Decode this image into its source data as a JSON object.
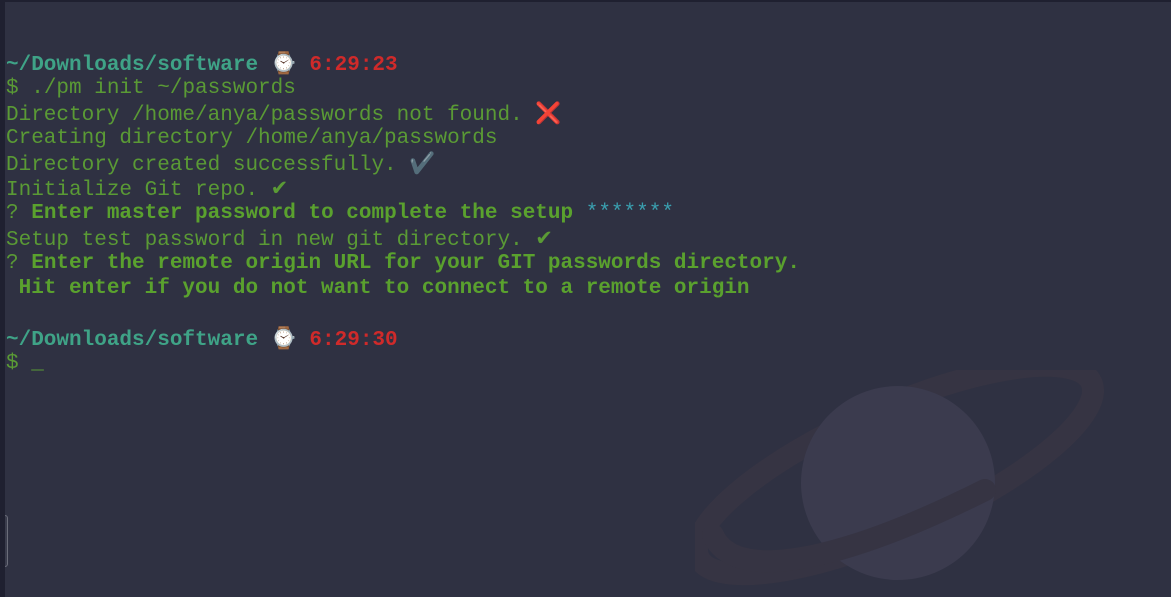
{
  "terminal": {
    "background_color": "#2f3142",
    "lines": [
      {
        "type": "blank"
      },
      {
        "type": "prompt",
        "path": "~/Downloads/software",
        "clock_icon": "⌚",
        "time": "6:29:23"
      },
      {
        "type": "command",
        "symbol": "$",
        "text": "./pm init ~/passwords"
      },
      {
        "type": "output",
        "text": "Directory /home/anya/passwords not found.",
        "icon": "❌",
        "icon_name": "cross-mark-icon"
      },
      {
        "type": "output",
        "text": "Creating directory /home/anya/passwords"
      },
      {
        "type": "output",
        "text": "Directory created successfully.",
        "icon": "✔️",
        "icon_name": "heavy-check-icon"
      },
      {
        "type": "output",
        "text": "Initialize Git repo.",
        "icon": "✔",
        "icon_name": "check-icon"
      },
      {
        "type": "question",
        "mark": "?",
        "text": "Enter master password to complete the setup",
        "masked": "*******"
      },
      {
        "type": "output",
        "text": "Setup test password in new git directory.",
        "icon": "✔",
        "icon_name": "check-icon"
      },
      {
        "type": "question",
        "mark": "?",
        "text": "Enter the remote origin URL for your GIT passwords directory."
      },
      {
        "type": "question-cont",
        "text": " Hit enter if you do not want to connect to a remote origin"
      },
      {
        "type": "blank"
      },
      {
        "type": "prompt",
        "path": "~/Downloads/software",
        "clock_icon": "⌚",
        "time": "6:29:30"
      },
      {
        "type": "command",
        "symbol": "$",
        "text": "",
        "cursor": "_"
      }
    ]
  },
  "colors": {
    "path": "#3fa387",
    "time": "#d02a2a",
    "output": "#5a9a35",
    "masked": "#3aa0b0"
  }
}
